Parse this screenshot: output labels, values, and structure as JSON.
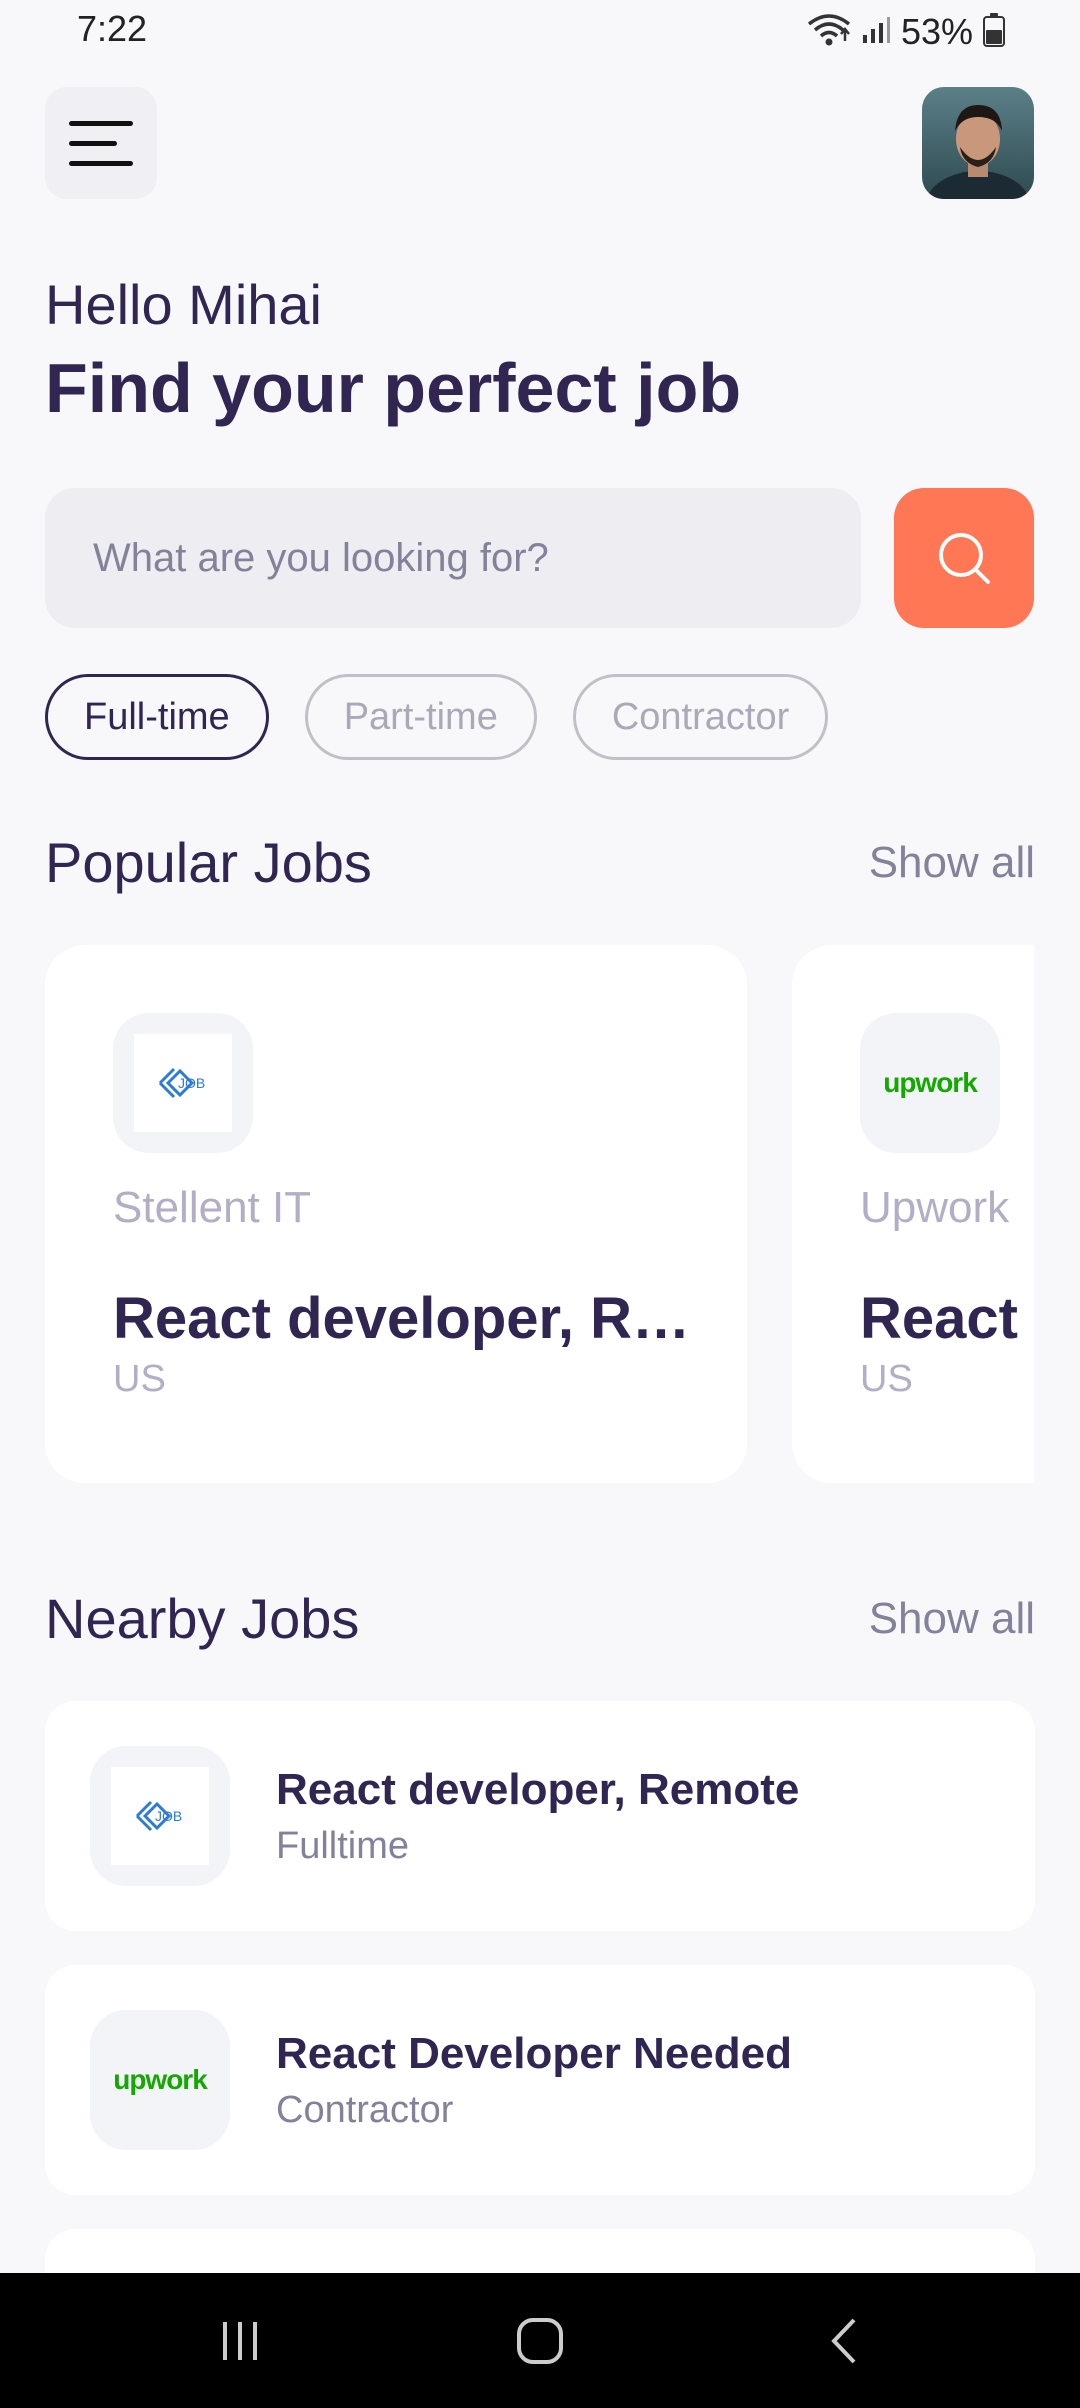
{
  "status_bar": {
    "time": "7:22",
    "battery": "53%",
    "icons": [
      "wifi-icon",
      "signal-icon",
      "battery-icon"
    ]
  },
  "header": {
    "menu_icon": "menu-icon",
    "avatar": "profile-avatar"
  },
  "welcome": {
    "greeting": "Hello Mihai",
    "headline": "Find your perfect job"
  },
  "search": {
    "placeholder": "What are you looking for?",
    "value": "",
    "button_icon": "search-icon"
  },
  "filters": {
    "items": [
      {
        "label": "Full-time",
        "active": true
      },
      {
        "label": "Part-time",
        "active": false
      },
      {
        "label": "Contractor",
        "active": false
      }
    ]
  },
  "popular": {
    "title": "Popular Jobs",
    "show_all": "Show all",
    "cards": [
      {
        "company": "Stellent IT",
        "title": "React developer, Re…",
        "location": "US",
        "logo": "job-logo"
      },
      {
        "company": "Upwork",
        "title": "React Developer Needed",
        "location": "US",
        "logo": "upwork-logo",
        "logo_text": "upwork"
      }
    ]
  },
  "nearby": {
    "title": "Nearby Jobs",
    "show_all": "Show all",
    "items": [
      {
        "title": "React developer, Remote",
        "type": "Fulltime",
        "logo": "job-logo"
      },
      {
        "title": "React Developer Needed",
        "type": "Contractor",
        "logo": "upwork-logo",
        "logo_text": "upwork"
      }
    ]
  },
  "colors": {
    "primary": "#312651",
    "accent": "#FF7754",
    "gray": "#83829A",
    "background": "#F8F8FB",
    "upwork_green": "#14A800"
  },
  "navbar": {
    "icons": [
      "recent-apps-icon",
      "home-icon",
      "back-icon"
    ]
  }
}
